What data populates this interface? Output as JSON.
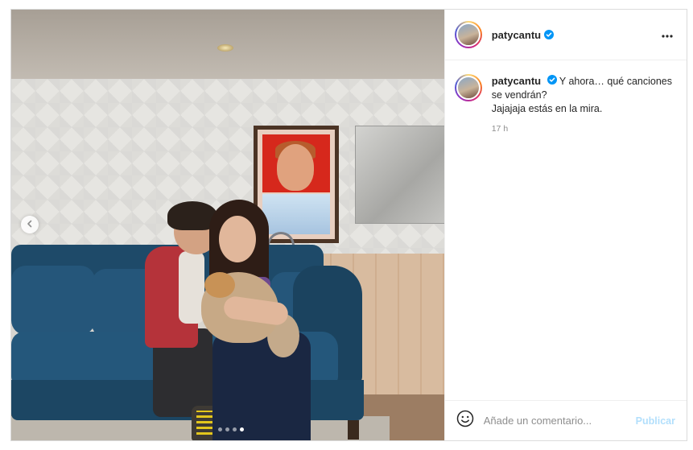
{
  "post": {
    "username": "patycantu",
    "verified": true,
    "carousel": {
      "total_slides": 4,
      "active_index": 3
    },
    "photo_icon": "prev-arrow-icon"
  },
  "caption": {
    "username": "patycantu",
    "text_line1": "Y ahora… qué canciones se vendrán?",
    "text_line2": "Jajajaja estás en la mira.",
    "time": "17 h"
  },
  "comment_box": {
    "placeholder": "Añade un comentario...",
    "publish_label": "Publicar"
  },
  "colors": {
    "verified_blue": "#0095f6",
    "publish_disabled": "#b2dffc"
  },
  "icons": [
    "more-options-icon",
    "verified-icon",
    "emoji-icon",
    "chevron-left-icon"
  ]
}
